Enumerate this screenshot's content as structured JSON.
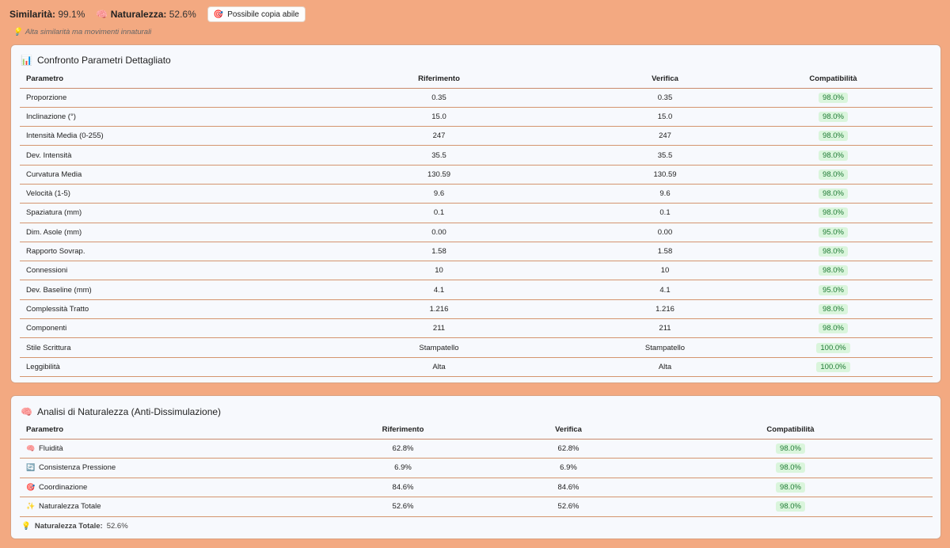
{
  "header": {
    "similarity_label": "Similarità:",
    "similarity_value": "99.1%",
    "naturalness_label": "Naturalezza:",
    "naturalness_value": "52.6%",
    "badge_label": "Possibile copia abile",
    "hint": "Alta similarità ma movimenti innaturali"
  },
  "param_table": {
    "title": "Confronto Parametri Dettagliato",
    "headers": [
      "Parametro",
      "Riferimento",
      "Verifica",
      "Compatibilità"
    ],
    "rows": [
      [
        "Proporzione",
        "0.35",
        "0.35",
        "98.0%"
      ],
      [
        "Inclinazione (°)",
        "15.0",
        "15.0",
        "98.0%"
      ],
      [
        "Intensità Media (0-255)",
        "247",
        "247",
        "98.0%"
      ],
      [
        "Dev. Intensità",
        "35.5",
        "35.5",
        "98.0%"
      ],
      [
        "Curvatura Media",
        "130.59",
        "130.59",
        "98.0%"
      ],
      [
        "Velocità (1-5)",
        "9.6",
        "9.6",
        "98.0%"
      ],
      [
        "Spaziatura (mm)",
        "0.1",
        "0.1",
        "98.0%"
      ],
      [
        "Dim. Asole (mm)",
        "0.00",
        "0.00",
        "95.0%"
      ],
      [
        "Rapporto Sovrap.",
        "1.58",
        "1.58",
        "98.0%"
      ],
      [
        "Connessioni",
        "10",
        "10",
        "98.0%"
      ],
      [
        "Dev. Baseline (mm)",
        "4.1",
        "4.1",
        "95.0%"
      ],
      [
        "Complessità Tratto",
        "1.216",
        "1.216",
        "98.0%"
      ],
      [
        "Componenti",
        "211",
        "211",
        "98.0%"
      ],
      [
        "Stile Scrittura",
        "Stampatello",
        "Stampatello",
        "100.0%"
      ],
      [
        "Leggibilità",
        "Alta",
        "Alta",
        "100.0%"
      ]
    ]
  },
  "nat_table": {
    "title": "Analisi di Naturalezza (Anti-Dissimulazione)",
    "headers": [
      "Parametro",
      "Riferimento",
      "Verifica",
      "Compatibilità"
    ],
    "rows": [
      {
        "icon": "brain-icon",
        "glyph": "🧠",
        "label": "Fluidità",
        "ref": "62.8%",
        "ver": "62.8%",
        "comp": "98.0%"
      },
      {
        "icon": "repeat-icon",
        "glyph": "🔄",
        "label": "Consistenza Pressione",
        "ref": "6.9%",
        "ver": "6.9%",
        "comp": "98.0%"
      },
      {
        "icon": "target-icon",
        "glyph": "🎯",
        "label": "Coordinazione",
        "ref": "84.6%",
        "ver": "84.6%",
        "comp": "98.0%"
      },
      {
        "icon": "sparkles-icon",
        "glyph": "✨",
        "label": "Naturalezza Totale",
        "ref": "52.6%",
        "ver": "52.6%",
        "comp": "98.0%"
      }
    ],
    "footer_label": "Naturalezza Totale:",
    "footer_value": "52.6%"
  },
  "colors": {
    "background": "#f3a981",
    "card": "#f7f9fd",
    "pill_bg": "#daf5dc",
    "pill_text": "#1f7a35"
  }
}
